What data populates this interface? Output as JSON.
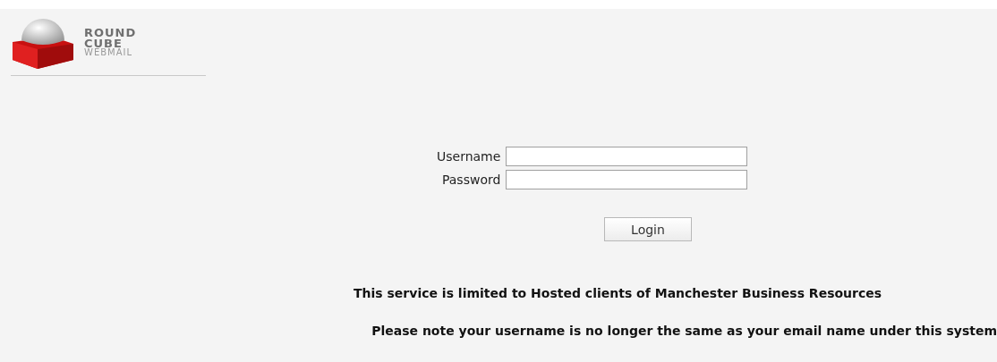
{
  "logo": {
    "lines": [
      "ROUND",
      "CUBE",
      "WEBMAIL"
    ]
  },
  "login_form": {
    "fields": [
      {
        "label": "Username"
      },
      {
        "label": "Password"
      }
    ],
    "button": "Login"
  },
  "notices": [
    "This service is limited to Hosted clients of Manchester Business Resources",
    "Please note your username is no longer the same as your email name under this system"
  ]
}
